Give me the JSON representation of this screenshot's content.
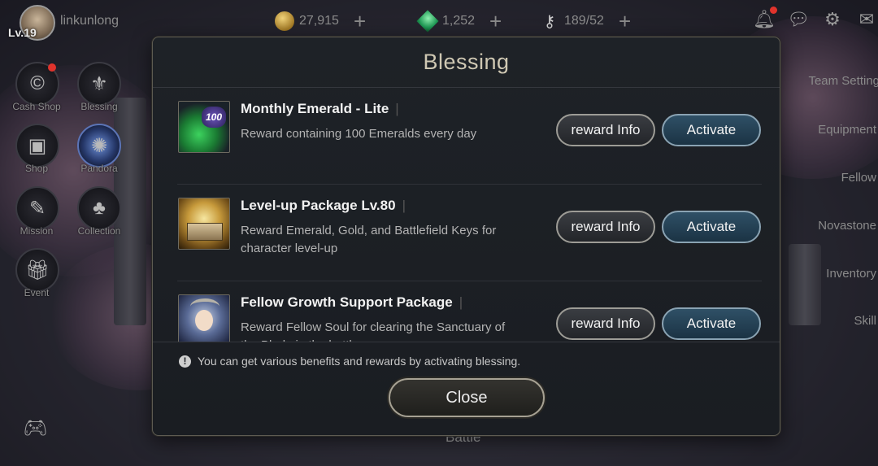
{
  "player": {
    "level": "Lv.19",
    "name": "linkunlong"
  },
  "currencies": [
    {
      "icon": "gold-coin-icon",
      "value": "27,915"
    },
    {
      "icon": "emerald-icon",
      "value": "1,252"
    },
    {
      "icon": "battlefield-key-icon",
      "value": "189/52"
    }
  ],
  "left_menu": [
    {
      "label": "Cash Shop",
      "icon": "cash-shop-icon",
      "notify": true
    },
    {
      "label": "Blessing",
      "icon": "blessing-icon",
      "notify": false
    },
    {
      "label": "Shop",
      "icon": "shop-chest-icon",
      "notify": false
    },
    {
      "label": "Pandora",
      "icon": "pandora-icon",
      "notify": false
    },
    {
      "label": "Mission",
      "icon": "mission-scroll-icon",
      "notify": false
    },
    {
      "label": "Collection",
      "icon": "collection-book-icon",
      "notify": false
    },
    {
      "label": "Event",
      "icon": "event-gift-icon",
      "notify": false
    }
  ],
  "right_menu": [
    "Team Setting",
    "Equipment",
    "Fellow",
    "Novastone",
    "Inventory",
    "Skill"
  ],
  "battle_label": "Battle",
  "modal": {
    "title": "Blessing",
    "items": [
      {
        "title": "Monthly Emerald - Lite",
        "description": "Reward containing 100 Emeralds every day",
        "badge": "100",
        "info_label": "reward Info",
        "activate_label": "Activate"
      },
      {
        "title": "Level-up Package Lv.80",
        "description": "Reward Emerald, Gold, and Battlefield Keys for character level-up",
        "info_label": "reward Info",
        "activate_label": "Activate"
      },
      {
        "title": "Fellow Growth Support Package",
        "description": "Reward Fellow Soul for clearing the Sanctuary of the Blade in the battle",
        "info_label": "reward Info",
        "activate_label": "Activate"
      }
    ],
    "notice": "You can get various benefits and rewards by activating blessing.",
    "close_label": "Close"
  }
}
